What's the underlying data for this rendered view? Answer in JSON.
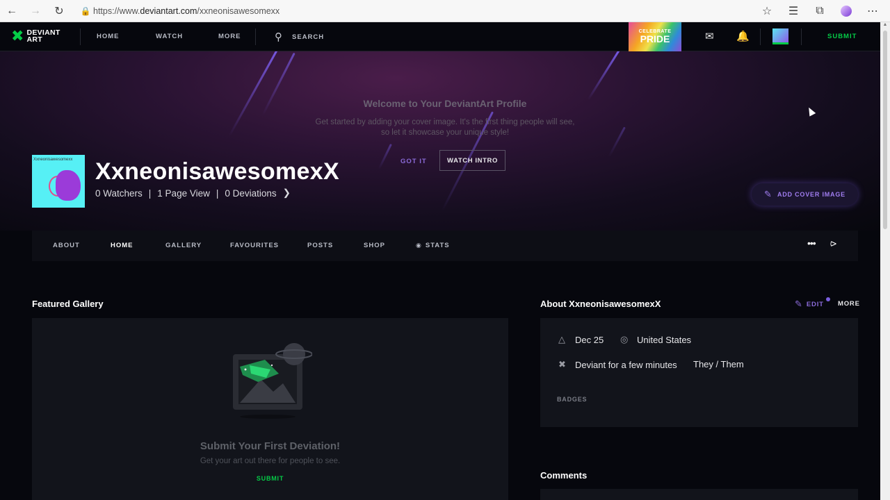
{
  "browser": {
    "url_prefix": "https://www.",
    "url_host": "deviantart.com",
    "url_path": "/xxneonisawesomexx"
  },
  "nav": {
    "logo_line1": "DEVIANT",
    "logo_line2": "ART",
    "home": "HOME",
    "watch": "WATCH",
    "more": "MORE",
    "search": "SEARCH",
    "promo_line1": "CELEBRATE",
    "promo_line2": "PRIDE",
    "submit": "SUBMIT"
  },
  "cover": {
    "welcome_title": "Welcome to Your DeviantArt Profile",
    "welcome_line1": "Get started by adding your cover image. It's the first thing people will see,",
    "welcome_line2": "so let it showcase your unique style!",
    "got_it": "GOT IT",
    "watch_intro": "WATCH INTRO",
    "add_cover": "ADD COVER IMAGE"
  },
  "profile": {
    "avatar_text": "Xxneonisawesomexx",
    "name": "XxneonisawesomexX",
    "watchers": "0 Watchers",
    "page_views": "1 Page View",
    "deviations": "0 Deviations",
    "separator": "|"
  },
  "tabs": [
    "ABOUT",
    "HOME",
    "GALLERY",
    "FAVOURITES",
    "POSTS",
    "SHOP",
    "STATS"
  ],
  "featured": {
    "title": "Featured Gallery",
    "empty_title": "Submit Your First Deviation!",
    "empty_sub": "Get your art out there for people to see.",
    "submit": "SUBMIT"
  },
  "about": {
    "title": "About XxneonisawesomexX",
    "edit": "EDIT",
    "more": "MORE",
    "birthday": "Dec 25",
    "location": "United States",
    "member_for": "Deviant for a few minutes",
    "pronouns": "They / Them",
    "badges": "BADGES"
  },
  "comments": {
    "title": "Comments"
  },
  "colors": {
    "accent_green": "#05cc47",
    "accent_purple": "#8b6bd9"
  }
}
